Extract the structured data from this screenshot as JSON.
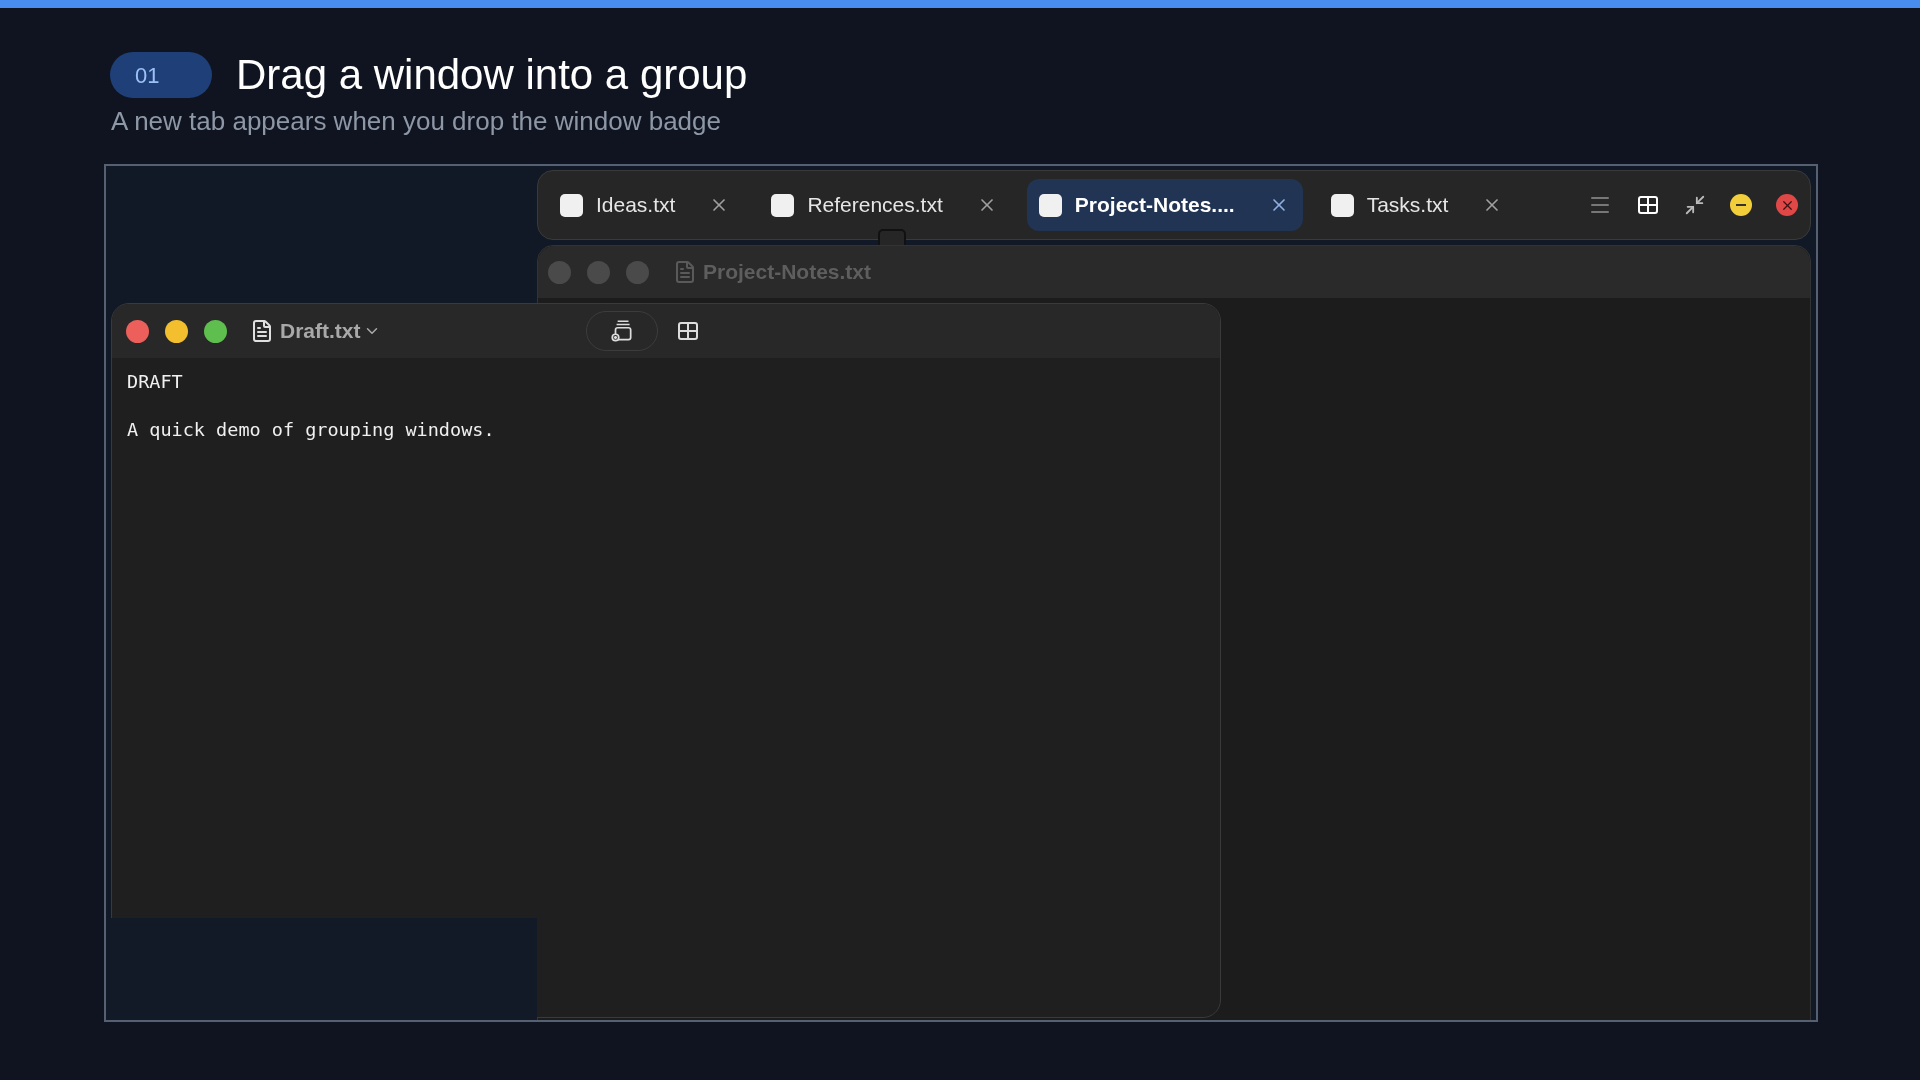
{
  "step": {
    "number": "01",
    "title": "Drag a window into a group",
    "subtitle": "A new tab appears when you drop the window badge"
  },
  "tab_group": {
    "tabs": [
      {
        "label": "Ideas.txt",
        "selected": false
      },
      {
        "label": "References.txt",
        "selected": false
      },
      {
        "label": "Project-Notes....",
        "selected": true
      },
      {
        "label": "Tasks.txt",
        "selected": false
      }
    ]
  },
  "back_window": {
    "title": "Project-Notes.txt"
  },
  "draft_window": {
    "title": "Draft.txt",
    "lines": [
      "DRAFT",
      "A quick demo of grouping windows."
    ]
  }
}
